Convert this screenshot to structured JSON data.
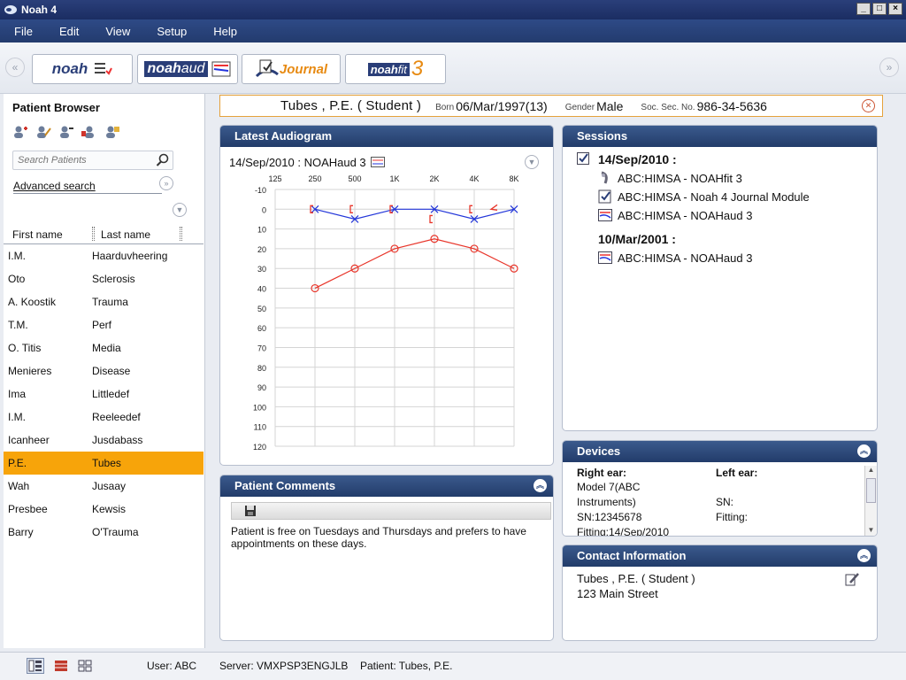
{
  "window": {
    "title": "Noah 4"
  },
  "menu": [
    "File",
    "Edit",
    "View",
    "Setup",
    "Help"
  ],
  "toolbar": {
    "modules": [
      {
        "name": "noah",
        "label": "noah"
      },
      {
        "name": "noahaud",
        "label_a": "noah",
        "label_b": "aud"
      },
      {
        "name": "journal",
        "label": "Journal"
      },
      {
        "name": "noahfit",
        "label_a": "noah",
        "label_b": "fit",
        "label_c": "3"
      }
    ]
  },
  "patient_browser": {
    "title": "Patient Browser",
    "search_placeholder": "Search Patients",
    "advanced_search": "Advanced search",
    "col_first": "First name",
    "col_last": "Last name",
    "patients": [
      {
        "first": "I.M.",
        "last": "Haarduvheering"
      },
      {
        "first": "Oto",
        "last": "Sclerosis"
      },
      {
        "first": "A. Koostik",
        "last": "Trauma"
      },
      {
        "first": "T.M.",
        "last": "Perf"
      },
      {
        "first": "O. Titis",
        "last": "Media"
      },
      {
        "first": "Menieres",
        "last": "Disease"
      },
      {
        "first": "Ima",
        "last": "Littledef"
      },
      {
        "first": "I.M.",
        "last": "Reeleedef"
      },
      {
        "first": "Icanheer",
        "last": "Jusdabass"
      },
      {
        "first": "P.E.",
        "last": "Tubes"
      },
      {
        "first": "Wah",
        "last": "Jusaay"
      },
      {
        "first": "Presbee",
        "last": "Kewsis"
      },
      {
        "first": "Barry",
        "last": "O'Trauma"
      }
    ],
    "selected_index": 9
  },
  "patient_header": {
    "name": "Tubes , P.E. ( Student )",
    "born_label": "Born",
    "born_value": "06/Mar/1997(13)",
    "gender_label": "Gender",
    "gender_value": "Male",
    "ssn_label": "Soc. Sec. No.",
    "ssn_value": "986-34-5636"
  },
  "audiogram_panel": {
    "title": "Latest Audiogram",
    "session": "14/Sep/2010 : NOAHaud 3"
  },
  "sessions_panel": {
    "title": "Sessions",
    "groups": [
      {
        "date": "14/Sep/2010 :",
        "items": [
          {
            "icon": "noahfit-icon",
            "text": "ABC:HIMSA  - NOAHfit 3"
          },
          {
            "icon": "journal-icon",
            "text": "ABC:HIMSA  - Noah 4 Journal Module"
          },
          {
            "icon": "audiogram-icon",
            "text": "ABC:HIMSA  - NOAHaud 3"
          }
        ]
      },
      {
        "date": "10/Mar/2001 :",
        "items": [
          {
            "icon": "audiogram-icon",
            "text": "ABC:HIMSA  - NOAHaud 3"
          }
        ]
      }
    ]
  },
  "comments_panel": {
    "title": "Patient Comments",
    "text": "Patient is free on Tuesdays and Thursdays and prefers to have appointments on these days."
  },
  "devices_panel": {
    "title": "Devices",
    "right_label": "Right ear:",
    "left_label": "Left ear:",
    "right_model_1": "Model 7(ABC",
    "right_model_2": "Instruments)",
    "right_sn": "SN:12345678",
    "right_fitting": "Fitting:14/Sep/2010",
    "left_sn": "SN:",
    "left_fitting": "Fitting:"
  },
  "contact_panel": {
    "title": "Contact Information",
    "name": "Tubes , P.E. ( Student )",
    "address": "123 Main Street"
  },
  "statusbar": {
    "user": "User: ABC",
    "server": "Server: VMXPSP3ENGJLB",
    "patient": "Patient: Tubes, P.E."
  },
  "chart_data": {
    "type": "line",
    "x_ticks": [
      "125",
      "250",
      "500",
      "1K",
      "2K",
      "4K",
      "8K"
    ],
    "y_ticks": [
      "-10",
      "0",
      "10",
      "20",
      "30",
      "40",
      "50",
      "60",
      "70",
      "80",
      "90",
      "100",
      "110",
      "120"
    ],
    "ylim": [
      -10,
      120
    ],
    "y_inverted": true,
    "grid": true,
    "series": [
      {
        "symbol": "O",
        "color": "#e8352a",
        "x": [
          "250",
          "500",
          "1K",
          "2K",
          "4K",
          "8K"
        ],
        "values": [
          40,
          30,
          20,
          15,
          20,
          30
        ]
      },
      {
        "symbol": "X",
        "color": "#2336d9",
        "x": [
          "250",
          "500",
          "1K",
          "2K",
          "4K",
          "8K"
        ],
        "values": [
          0,
          5,
          0,
          0,
          5,
          0
        ]
      }
    ],
    "markers": [
      {
        "symbol": "[",
        "color": "#e8352a",
        "x": "250",
        "value": 0
      },
      {
        "symbol": "[",
        "color": "#e8352a",
        "x": "500",
        "value": 0
      },
      {
        "symbol": "[",
        "color": "#e8352a",
        "x": "1K",
        "value": 0
      },
      {
        "symbol": "[",
        "color": "#e8352a",
        "x": "2K",
        "value": 5
      },
      {
        "symbol": "[",
        "color": "#e8352a",
        "x": "4K",
        "value": 0
      },
      {
        "symbol": "<",
        "color": "#e8352a",
        "x": "4K",
        "value": 0,
        "offset": 1
      }
    ]
  }
}
